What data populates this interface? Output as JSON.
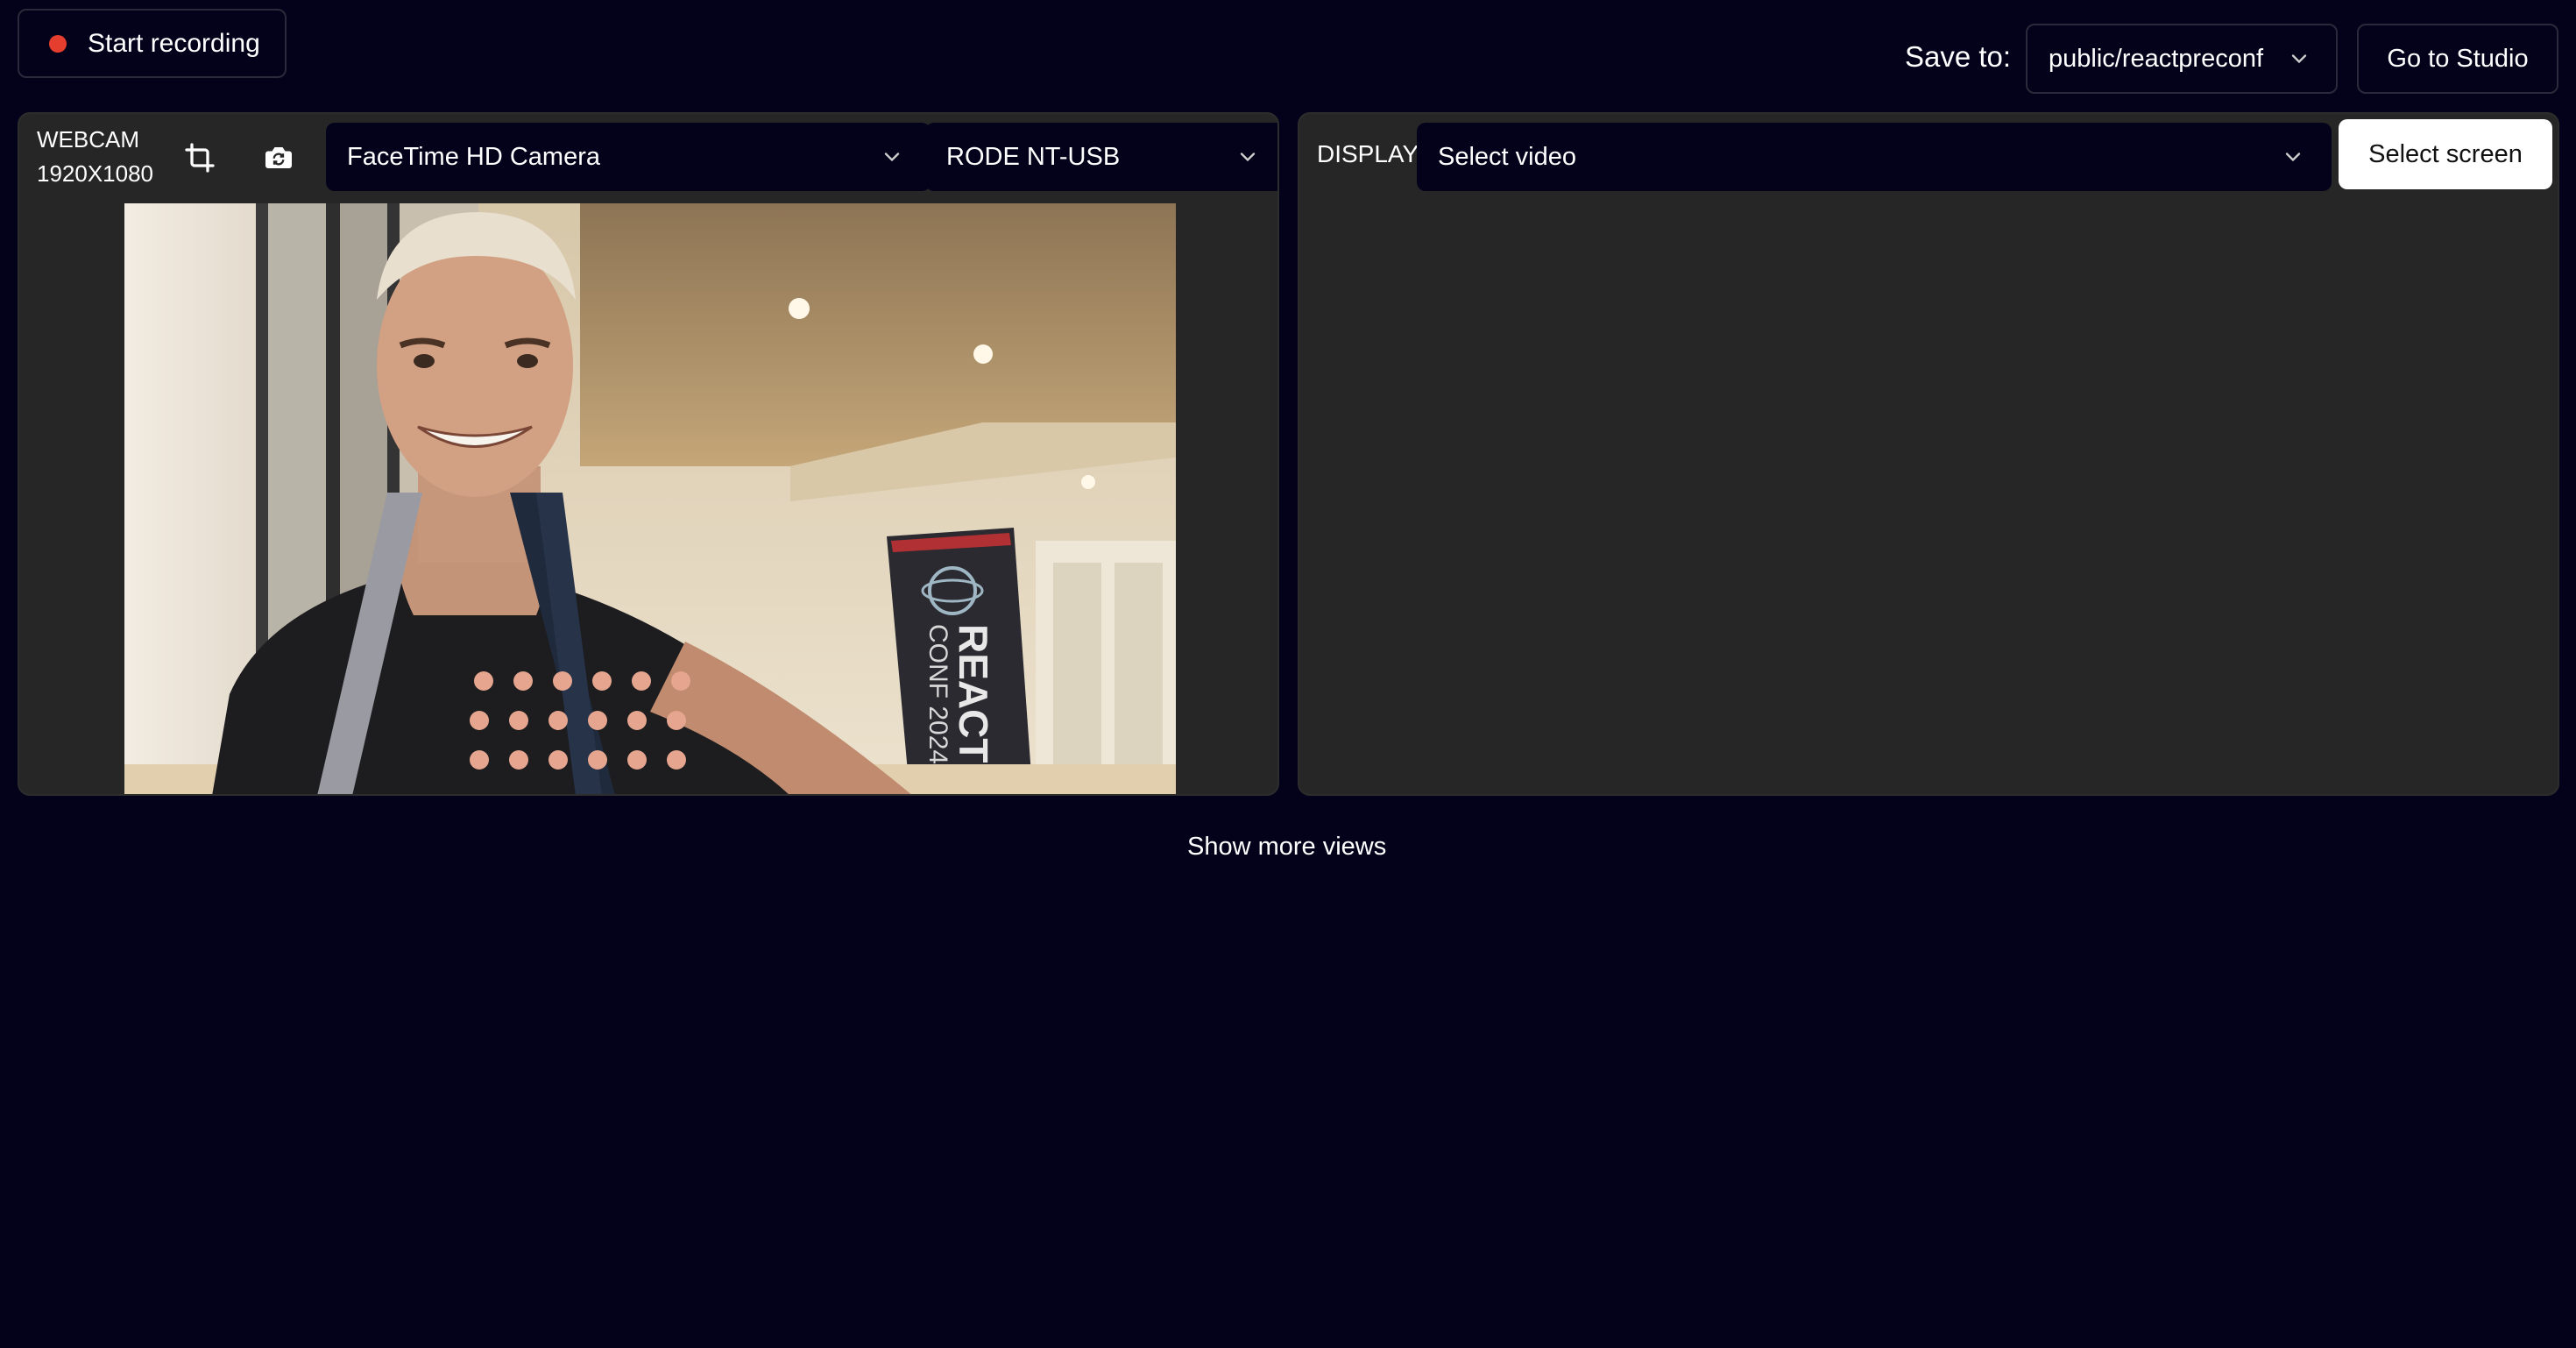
{
  "toolbar": {
    "record_label": "Start recording",
    "save_to_label": "Save to:",
    "save_path": "public/reactpreconf",
    "studio_label": "Go to Studio"
  },
  "webcam": {
    "title": "WEBCAM",
    "resolution": "1920X1080",
    "camera": "FaceTime HD Camera",
    "microphone": "RODE NT-USB",
    "banner_line1": "REACT",
    "banner_line2": "CONF 2024"
  },
  "display": {
    "title": "DISPLAY",
    "video_placeholder": "Select video",
    "select_screen_label": "Select screen"
  },
  "footer": {
    "show_more_label": "Show more views"
  },
  "colors": {
    "background": "#03021a",
    "panel": "#262626",
    "record_dot": "#e53e2e"
  }
}
